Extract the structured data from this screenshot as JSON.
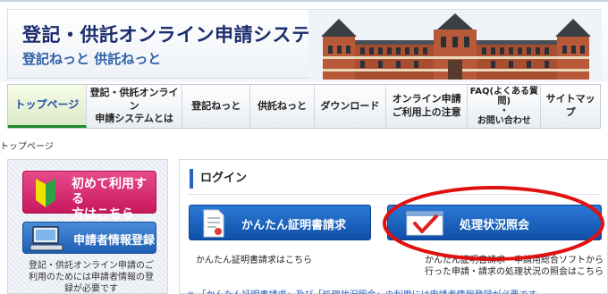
{
  "header": {
    "title": "登記・供託オンライン申請システム",
    "subtitle": "登記ねっと 供託ねっと"
  },
  "nav": {
    "items": [
      {
        "label": "トップページ",
        "active": true
      },
      {
        "label": "登記・供託オンライン\n申請システムとは"
      },
      {
        "label": "登記ねっと"
      },
      {
        "label": "供託ねっと"
      },
      {
        "label": "ダウンロード"
      },
      {
        "label": "オンライン申請\nご利用上の注意"
      },
      {
        "label": "FAQ(よくある質問)\n・\nお問い合わせ"
      },
      {
        "label": "サイトマップ"
      }
    ]
  },
  "breadcrumb": "トップページ",
  "sidebar": {
    "first_time_label": "初めて利用する\n方はこちら",
    "register_label": "申請者情報登録",
    "register_desc": "登記・供託オンライン申請のご\n利用のためには申請者情報の登\n録が必要です"
  },
  "login": {
    "heading": "ログイン",
    "cert_button": "かんたん証明書請求",
    "cert_desc": "かんたん証明書請求はこちら",
    "status_button": "処理状況照会",
    "status_desc": "かんたん証明書請求・申請用総合ソフトから\n行った申請・請求の処理状況の照会はこちら",
    "bottom_note": "※ 「かんたん証明書請求」及び「処理状況照会」の利用には申請者情報登録が必要です。"
  },
  "colors": {
    "accent_blue": "#1f5fb4",
    "pink_button": "#d4226d",
    "highlight_red": "#e01010"
  }
}
